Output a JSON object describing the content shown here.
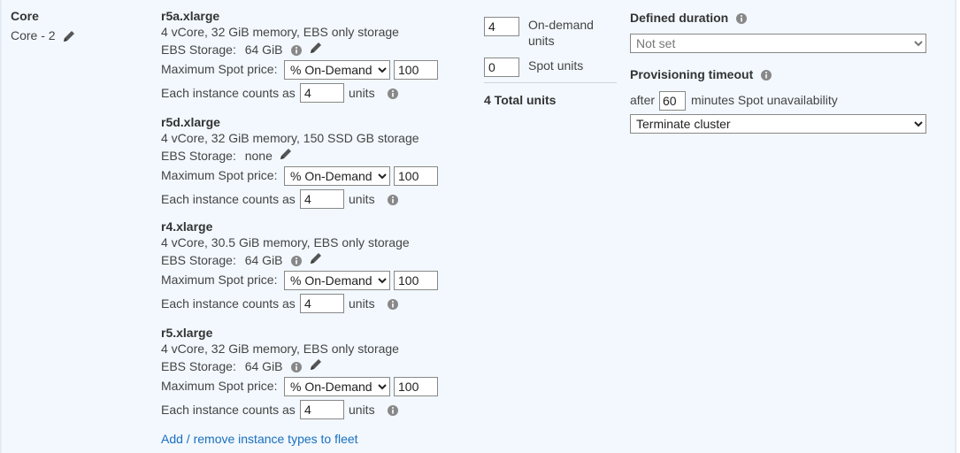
{
  "group": {
    "title": "Core",
    "subtitle": "Core - 2"
  },
  "instances": [
    {
      "name": "r5a.xlarge",
      "specs": "4 vCore, 32 GiB memory, EBS only storage",
      "ebs_label": "EBS Storage:",
      "ebs_value": "64 GiB",
      "has_info": true,
      "price_label": "Maximum Spot price:",
      "price_option": "% On-Demand",
      "price_value": "100",
      "counts_label": "Each instance counts as",
      "counts_value": "4",
      "units_label": "units"
    },
    {
      "name": "r5d.xlarge",
      "specs": "4 vCore, 32 GiB memory, 150 SSD GB storage",
      "ebs_label": "EBS Storage:",
      "ebs_value": "none",
      "has_info": false,
      "price_label": "Maximum Spot price:",
      "price_option": "% On-Demand",
      "price_value": "100",
      "counts_label": "Each instance counts as",
      "counts_value": "4",
      "units_label": "units"
    },
    {
      "name": "r4.xlarge",
      "specs": "4 vCore, 30.5 GiB memory, EBS only storage",
      "ebs_label": "EBS Storage:",
      "ebs_value": "64 GiB",
      "has_info": true,
      "price_label": "Maximum Spot price:",
      "price_option": "% On-Demand",
      "price_value": "100",
      "counts_label": "Each instance counts as",
      "counts_value": "4",
      "units_label": "units"
    },
    {
      "name": "r5.xlarge",
      "specs": "4 vCore, 32 GiB memory, EBS only storage",
      "ebs_label": "EBS Storage:",
      "ebs_value": "64 GiB",
      "has_info": true,
      "price_label": "Maximum Spot price:",
      "price_option": "% On-Demand",
      "price_value": "100",
      "counts_label": "Each instance counts as",
      "counts_value": "4",
      "units_label": "units"
    }
  ],
  "add_remove_link": "Add / remove instance types to fleet",
  "units": {
    "on_demand_value": "4",
    "on_demand_label_1": "On-demand",
    "on_demand_label_2": "units",
    "spot_value": "0",
    "spot_label": "Spot units",
    "total": "4 Total units"
  },
  "duration": {
    "label": "Defined duration",
    "value": "Not set"
  },
  "timeout": {
    "label": "Provisioning timeout",
    "after": "after",
    "minutes_value": "60",
    "minutes_text": "minutes Spot unavailability",
    "action": "Terminate cluster"
  },
  "colors": {
    "panel_bg": "#f2f8fd",
    "link": "#1a6fbf"
  }
}
